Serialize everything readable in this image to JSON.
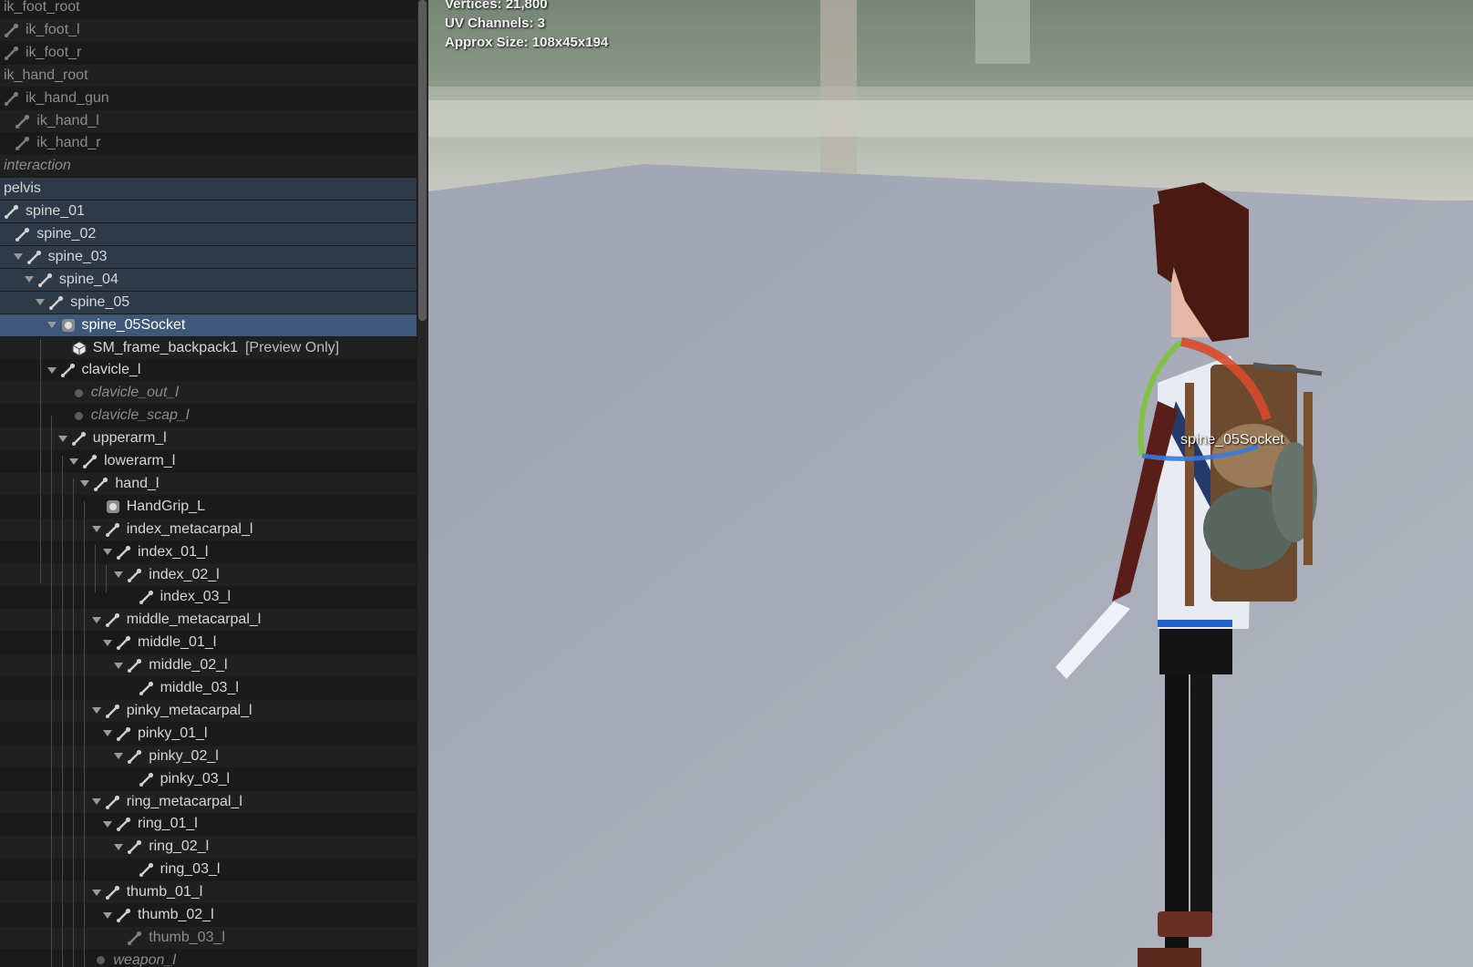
{
  "skeleton_tree": {
    "rows": [
      {
        "label": "ik_foot_root",
        "depth": 0,
        "icon": "none",
        "state": "dim"
      },
      {
        "label": "ik_foot_l",
        "depth": 0,
        "icon": "bone-icon",
        "state": "dim"
      },
      {
        "label": "ik_foot_r",
        "depth": 0,
        "icon": "bone-icon",
        "state": "dim"
      },
      {
        "label": "ik_hand_root",
        "depth": 0,
        "icon": "none",
        "state": "dim"
      },
      {
        "label": "ik_hand_gun",
        "depth": 0,
        "icon": "bone-icon",
        "state": "dim"
      },
      {
        "label": "ik_hand_l",
        "depth": 1,
        "icon": "bone-icon",
        "state": "dim"
      },
      {
        "label": "ik_hand_r",
        "depth": 1,
        "icon": "bone-icon",
        "state": "dim"
      },
      {
        "label": "interaction",
        "depth": 0,
        "icon": "none",
        "state": "dim-italic"
      },
      {
        "label": "pelvis",
        "depth": 0,
        "icon": "none",
        "state": "selected"
      },
      {
        "label": "spine_01",
        "depth": 0,
        "icon": "bone-icon",
        "state": "selected"
      },
      {
        "label": "spine_02",
        "depth": 1,
        "icon": "bone-icon",
        "state": "selected"
      },
      {
        "label": "spine_03",
        "depth": 2,
        "icon": "bone-icon",
        "state": "selected",
        "expanded": true
      },
      {
        "label": "spine_04",
        "depth": 3,
        "icon": "bone-icon",
        "state": "selected",
        "expanded": true
      },
      {
        "label": "spine_05",
        "depth": 4,
        "icon": "bone-icon",
        "state": "selected",
        "expanded": true
      },
      {
        "label": "spine_05Socket",
        "depth": 5,
        "icon": "socket-icon",
        "state": "active",
        "expanded": true
      },
      {
        "label": "SM_frame_backpack1",
        "depth": 6,
        "icon": "mesh-icon",
        "state": "normal",
        "suffix": "[Preview Only]"
      },
      {
        "label": "clavicle_l",
        "depth": 5,
        "icon": "bone-icon",
        "state": "normal",
        "expanded": true
      },
      {
        "label": "clavicle_out_l",
        "depth": 6,
        "icon": "dot-icon",
        "state": "dim-italic"
      },
      {
        "label": "clavicle_scap_l",
        "depth": 6,
        "icon": "dot-icon",
        "state": "dim-italic"
      },
      {
        "label": "upperarm_l",
        "depth": 6,
        "icon": "bone-icon",
        "state": "normal",
        "expanded": true
      },
      {
        "label": "lowerarm_l",
        "depth": 7,
        "icon": "bone-icon",
        "state": "normal",
        "expanded": true
      },
      {
        "label": "hand_l",
        "depth": 8,
        "icon": "bone-icon",
        "state": "normal",
        "expanded": true
      },
      {
        "label": "HandGrip_L",
        "depth": 9,
        "icon": "socket-icon",
        "state": "normal"
      },
      {
        "label": "index_metacarpal_l",
        "depth": 9,
        "icon": "bone-icon",
        "state": "normal",
        "expanded": true
      },
      {
        "label": "index_01_l",
        "depth": 10,
        "icon": "bone-icon",
        "state": "normal",
        "expanded": true
      },
      {
        "label": "index_02_l",
        "depth": 11,
        "icon": "bone-icon",
        "state": "normal",
        "expanded": true
      },
      {
        "label": "index_03_l",
        "depth": 12,
        "icon": "bone-icon",
        "state": "normal"
      },
      {
        "label": "middle_metacarpal_l",
        "depth": 9,
        "icon": "bone-icon",
        "state": "normal",
        "expanded": true
      },
      {
        "label": "middle_01_l",
        "depth": 10,
        "icon": "bone-icon",
        "state": "normal",
        "expanded": true
      },
      {
        "label": "middle_02_l",
        "depth": 11,
        "icon": "bone-icon",
        "state": "normal",
        "expanded": true
      },
      {
        "label": "middle_03_l",
        "depth": 12,
        "icon": "bone-icon",
        "state": "normal"
      },
      {
        "label": "pinky_metacarpal_l",
        "depth": 9,
        "icon": "bone-icon",
        "state": "normal",
        "expanded": true
      },
      {
        "label": "pinky_01_l",
        "depth": 10,
        "icon": "bone-icon",
        "state": "normal",
        "expanded": true
      },
      {
        "label": "pinky_02_l",
        "depth": 11,
        "icon": "bone-icon",
        "state": "normal",
        "expanded": true
      },
      {
        "label": "pinky_03_l",
        "depth": 12,
        "icon": "bone-icon",
        "state": "normal"
      },
      {
        "label": "ring_metacarpal_l",
        "depth": 9,
        "icon": "bone-icon",
        "state": "normal",
        "expanded": true
      },
      {
        "label": "ring_01_l",
        "depth": 10,
        "icon": "bone-icon",
        "state": "normal",
        "expanded": true
      },
      {
        "label": "ring_02_l",
        "depth": 11,
        "icon": "bone-icon",
        "state": "normal",
        "expanded": true
      },
      {
        "label": "ring_03_l",
        "depth": 12,
        "icon": "bone-icon",
        "state": "normal"
      },
      {
        "label": "thumb_01_l",
        "depth": 9,
        "icon": "bone-icon",
        "state": "normal",
        "expanded": true
      },
      {
        "label": "thumb_02_l",
        "depth": 10,
        "icon": "bone-icon",
        "state": "normal",
        "expanded": true
      },
      {
        "label": "thumb_03_l",
        "depth": 11,
        "icon": "bone-icon",
        "state": "dim"
      },
      {
        "label": "weapon_l",
        "depth": 8,
        "icon": "dot-icon",
        "state": "dim-italic"
      }
    ]
  },
  "viewport": {
    "stats": {
      "vertices": "Vertices: 21,800",
      "uv_channels": "UV Channels: 3",
      "approx_size": "Approx Size: 108x45x194"
    },
    "socket_label": "spine_05Socket"
  },
  "colors": {
    "panel_bg": "#1a1a1a",
    "row_alt": "#202020",
    "row_selected": "#2f3a49",
    "row_active": "#3d5878",
    "viewport_floor": "#a3a8b4"
  }
}
